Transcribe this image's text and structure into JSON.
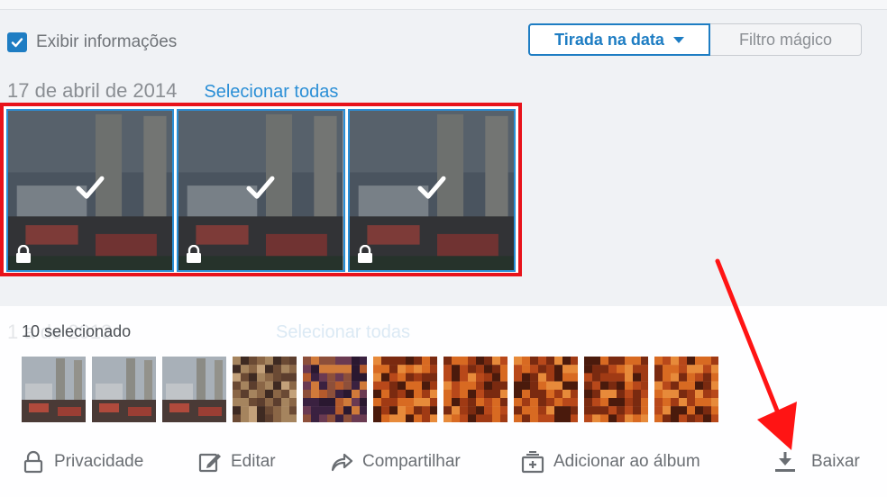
{
  "toolbar": {
    "show_info_label": "Exibir informações",
    "show_info_checked": true,
    "sort_options": [
      {
        "label": "Tirada na data",
        "active": true
      },
      {
        "label": "Filtro mágico",
        "active": false
      }
    ]
  },
  "group": {
    "date": "17 de abril de 2014",
    "select_all": "Selecionar todas",
    "photo_count": 3
  },
  "background_group": {
    "date_partial": "1         a de 2013",
    "select_all": "Selecionar todas"
  },
  "selection": {
    "count_label": "10 selecionado",
    "thumbnails": [
      {
        "kind": "city"
      },
      {
        "kind": "city"
      },
      {
        "kind": "city"
      },
      {
        "kind": "pixel-tan"
      },
      {
        "kind": "pixel-purple"
      },
      {
        "kind": "pixel-orange"
      },
      {
        "kind": "pixel-orange"
      },
      {
        "kind": "pixel-orange"
      },
      {
        "kind": "pixel-orange"
      },
      {
        "kind": "pixel-orange"
      }
    ]
  },
  "actions": {
    "privacy": "Privacidade",
    "edit": "Editar",
    "share": "Compartilhar",
    "add_album": "Adicionar ao álbum",
    "download": "Baixar"
  },
  "colors": {
    "accent": "#1e7dc3",
    "link": "#2b8fd6",
    "highlight": "#e8131b",
    "annotation": "#ff1414"
  }
}
